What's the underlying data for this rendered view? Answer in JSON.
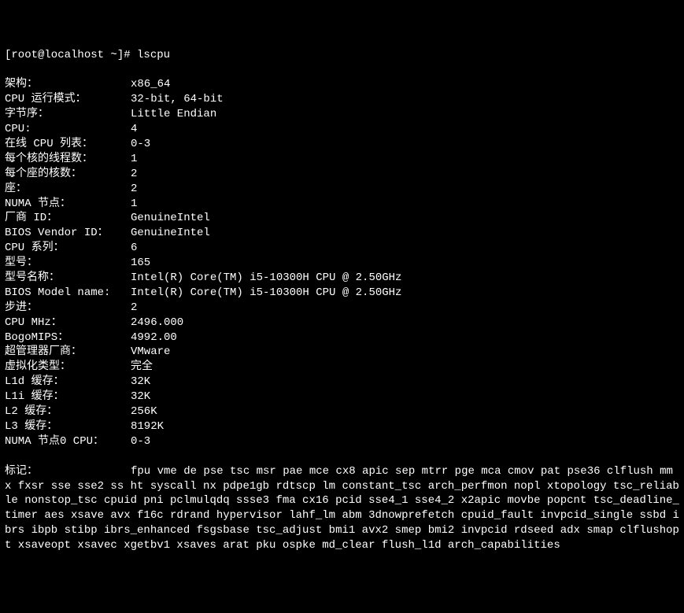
{
  "prompt": "[root@localhost ~]# ",
  "command": "lscpu",
  "rows": [
    {
      "label": "架构：",
      "value": "x86_64"
    },
    {
      "label": "CPU 运行模式：",
      "value": "32-bit, 64-bit"
    },
    {
      "label": "字节序：",
      "value": "Little Endian"
    },
    {
      "label": "CPU:",
      "value": "4"
    },
    {
      "label": "在线 CPU 列表：",
      "value": "0-3"
    },
    {
      "label": "每个核的线程数：",
      "value": "1"
    },
    {
      "label": "每个座的核数：",
      "value": "2"
    },
    {
      "label": "座：",
      "value": "2"
    },
    {
      "label": "NUMA 节点：",
      "value": "1"
    },
    {
      "label": "厂商 ID：",
      "value": "GenuineIntel"
    },
    {
      "label": "BIOS Vendor ID：",
      "value": "GenuineIntel"
    },
    {
      "label": "CPU 系列：",
      "value": "6"
    },
    {
      "label": "型号：",
      "value": "165"
    },
    {
      "label": "型号名称：",
      "value": "Intel(R) Core(TM) i5-10300H CPU @ 2.50GHz"
    },
    {
      "label": "BIOS Model name:",
      "value": "Intel(R) Core(TM) i5-10300H CPU @ 2.50GHz"
    },
    {
      "label": "步进：",
      "value": "2"
    },
    {
      "label": "CPU MHz：",
      "value": "2496.000"
    },
    {
      "label": "BogoMIPS：",
      "value": "4992.00"
    },
    {
      "label": "超管理器厂商：",
      "value": "VMware"
    },
    {
      "label": "虚拟化类型：",
      "value": "完全"
    },
    {
      "label": "L1d 缓存：",
      "value": "32K"
    },
    {
      "label": "L1i 缓存：",
      "value": "32K"
    },
    {
      "label": "L2 缓存：",
      "value": "256K"
    },
    {
      "label": "L3 缓存：",
      "value": "8192K"
    },
    {
      "label": "NUMA 节点0 CPU：",
      "value": "0-3"
    }
  ],
  "flags_label": "标记：",
  "flags_value": "fpu vme de pse tsc msr pae mce cx8 apic sep mtrr pge mca cmov pat pse36 clflush mmx fxsr sse sse2 ss ht syscall nx pdpe1gb rdtscp lm constant_tsc arch_perfmon nopl xtopology tsc_reliable nonstop_tsc cpuid pni pclmulqdq ssse3 fma cx16 pcid sse4_1 sse4_2 x2apic movbe popcnt tsc_deadline_timer aes xsave avx f16c rdrand hypervisor lahf_lm abm 3dnowprefetch cpuid_fault invpcid_single ssbd ibrs ibpb stibp ibrs_enhanced fsgsbase tsc_adjust bmi1 avx2 smep bmi2 invpcid rdseed adx smap clflushopt xsaveopt xsavec xgetbv1 xsaves arat pku ospke md_clear flush_l1d arch_capabilities"
}
